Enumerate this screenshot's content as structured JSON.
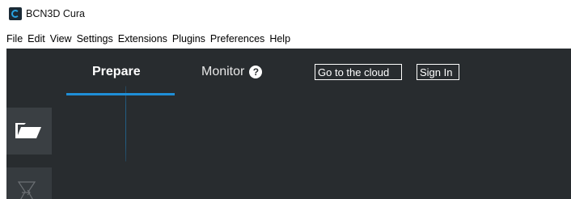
{
  "window": {
    "title": "BCN3D Cura",
    "icon": "bcn3d-cura-logo"
  },
  "menu": {
    "items": [
      "File",
      "Edit",
      "View",
      "Settings",
      "Extensions",
      "Plugins",
      "Preferences",
      "Help"
    ]
  },
  "stages": {
    "prepare": "Prepare",
    "monitor": "Monitor",
    "help_icon_glyph": "?"
  },
  "header_buttons": {
    "cloud": "Go to the cloud",
    "sign_in": "Sign In"
  },
  "tools": {
    "open": "folder-open-icon",
    "scale": "scale-icon"
  },
  "colors": {
    "app_background": "#282c2f",
    "accent": "#1f8fd7",
    "tool_background": "#3a3f43"
  }
}
